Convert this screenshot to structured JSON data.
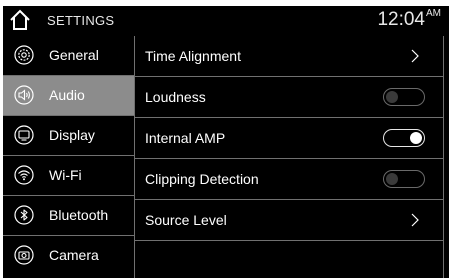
{
  "header": {
    "title": "SETTINGS",
    "time": "12:04",
    "ampm": "AM"
  },
  "sidebar": {
    "items": [
      {
        "label": "General",
        "icon": "gear-icon",
        "selected": false
      },
      {
        "label": "Audio",
        "icon": "speaker-icon",
        "selected": true
      },
      {
        "label": "Display",
        "icon": "display-icon",
        "selected": false
      },
      {
        "label": "Wi-Fi",
        "icon": "wifi-icon",
        "selected": false
      },
      {
        "label": "Bluetooth",
        "icon": "bluetooth-icon",
        "selected": false
      },
      {
        "label": "Camera",
        "icon": "camera-icon",
        "selected": false
      }
    ]
  },
  "settings": {
    "rows": [
      {
        "label": "Time Alignment",
        "control": "chevron"
      },
      {
        "label": "Loudness",
        "control": "toggle",
        "state": "off"
      },
      {
        "label": "Internal AMP",
        "control": "toggle",
        "state": "on"
      },
      {
        "label": "Clipping Detection",
        "control": "toggle",
        "state": "off"
      },
      {
        "label": "Source Level",
        "control": "chevron"
      }
    ]
  },
  "colors": {
    "background": "#000000",
    "selected_item": "#8c8c8c",
    "divider": "#707070",
    "text": "#ffffff"
  }
}
